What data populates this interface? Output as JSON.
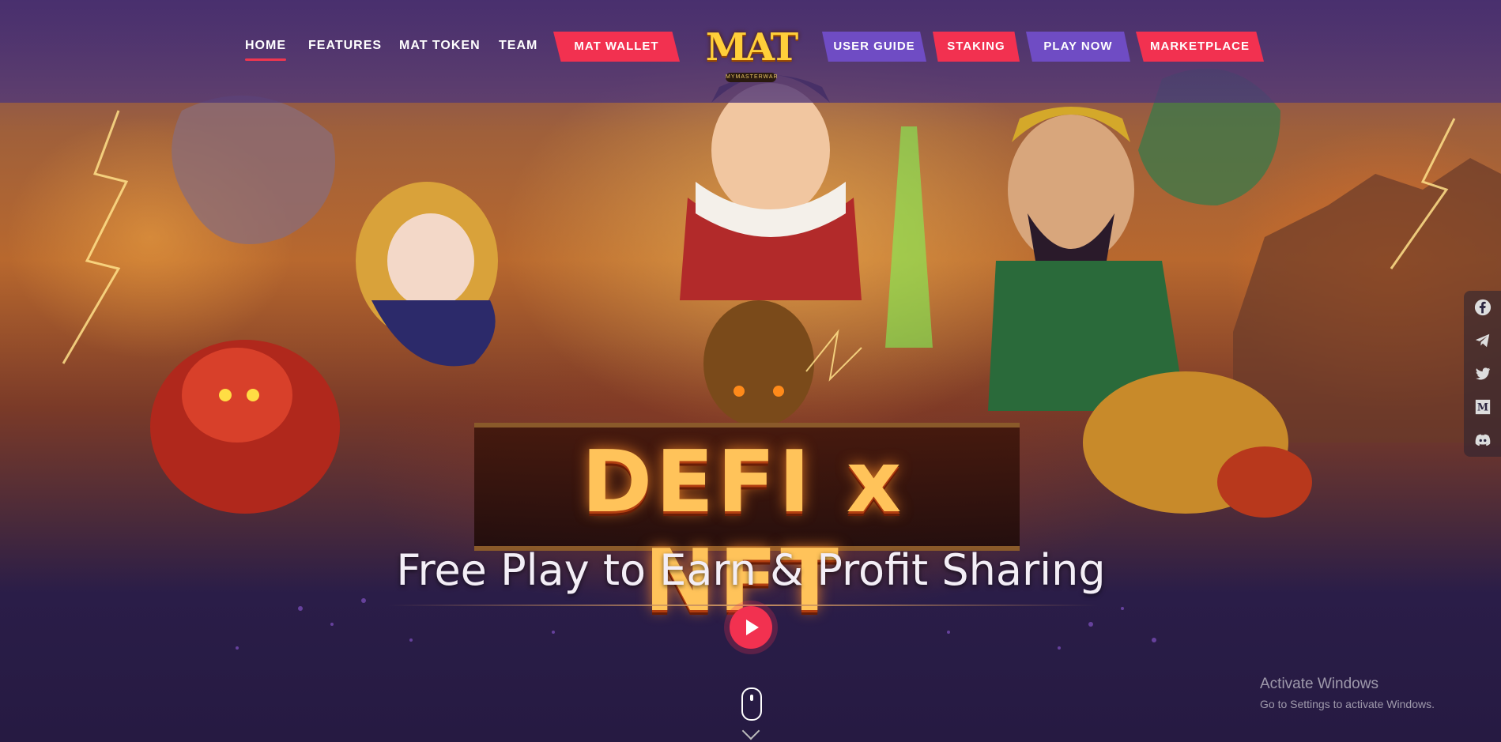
{
  "nav": {
    "left_links": [
      "HOME",
      "FEATURES",
      "MAT TOKEN",
      "TEAM"
    ],
    "active": "HOME",
    "buttons": {
      "wallet": "MAT WALLET",
      "user_guide": "USER GUIDE",
      "staking": "STAKING",
      "play_now": "PLAY NOW",
      "marketplace": "MARKETPLACE"
    }
  },
  "logo": {
    "text": "MAT",
    "subtitle": "MYMASTERWAR"
  },
  "hero": {
    "headline": "DEFI x NFT",
    "tagline": "Free Play to Earn & Profit Sharing"
  },
  "social": [
    "facebook-icon",
    "telegram-icon",
    "twitter-icon",
    "medium-icon",
    "discord-icon"
  ],
  "watermark": {
    "title": "Activate Windows",
    "subtitle": "Go to Settings to activate Windows."
  },
  "colors": {
    "accent_red": "#f23150",
    "accent_purple": "#6f4cc4",
    "gold": "#ffc35a"
  }
}
